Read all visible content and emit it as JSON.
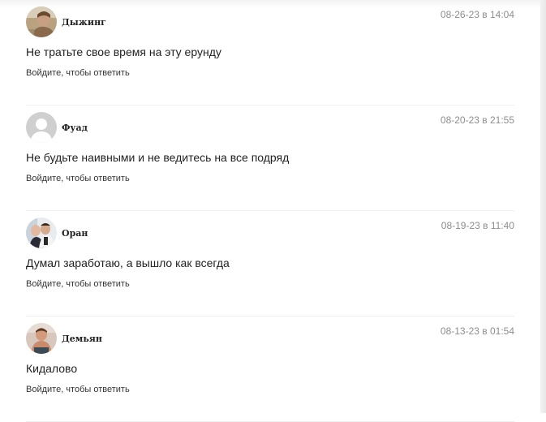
{
  "comments": [
    {
      "author": "Дыжинг",
      "date": "08-26-23 в 14:04",
      "text": "Не тратьте свое время на эту ерунду",
      "reply": "Войдите, чтобы ответить",
      "avatar": "photo-avatar"
    },
    {
      "author": "Фуад",
      "date": "08-20-23 в 21:55",
      "text": "Не будьте наивными и не ведитесь на все подряд",
      "reply": "Войдите, чтобы ответить",
      "avatar": "default-user-icon"
    },
    {
      "author": "Оран",
      "date": "08-19-23 в 11:40",
      "text": "Думал заработаю, а вышло как всегда",
      "reply": "Войдите, чтобы ответить",
      "avatar": "photo-avatar"
    },
    {
      "author": "Демьян",
      "date": "08-13-23 в 01:54",
      "text": "Кидалово",
      "reply": "Войдите, чтобы ответить",
      "avatar": "photo-avatar"
    }
  ],
  "colors": {
    "date": "#8d8d8d",
    "divider": "#efefef",
    "default_avatar": "#cfcfcf"
  }
}
